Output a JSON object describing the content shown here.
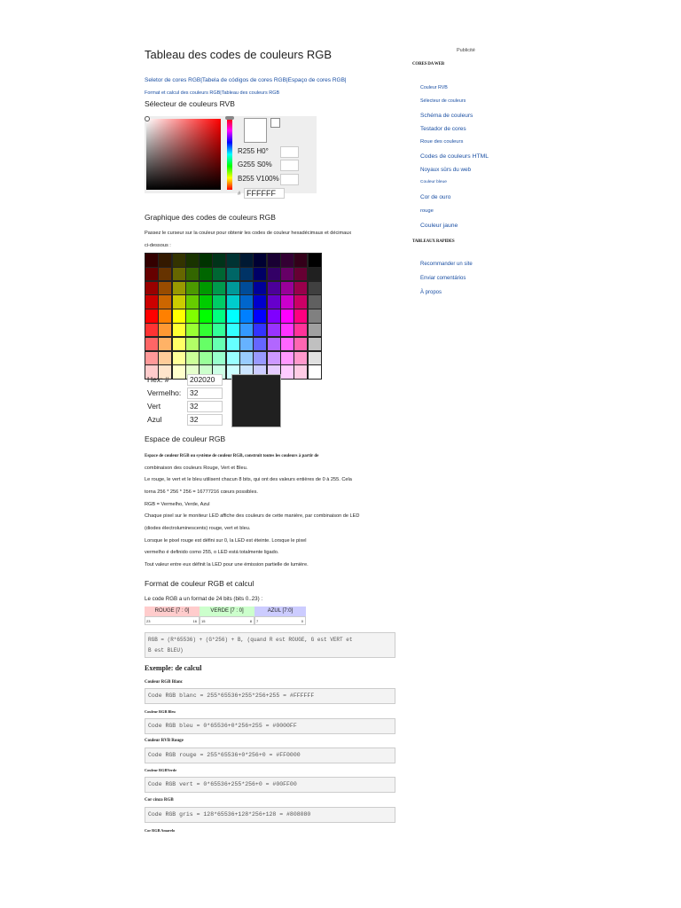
{
  "title": "Tableau des codes de couleurs RGB",
  "nav_links": {
    "line1": "Seletor de cores RGB|Tabela de códigos de cores RGB|Espaço de cores RGB|",
    "line2": "Format et calcul des couleurs RGB|Tableau des couleurs RGB"
  },
  "picker": {
    "heading": "Sélecteur de couleurs RVB",
    "r_label": "R",
    "r_val": "255",
    "h_label": "H",
    "h_val": "0",
    "h_unit": "°",
    "g_label": "G",
    "g_val": "255",
    "s_label": "S",
    "s_val": "0",
    "s_unit": "%",
    "b_label": "B",
    "b_val": "255",
    "v_label": "V",
    "v_val": "100",
    "v_unit": "%",
    "hex_symbol": "#",
    "hex": "FFFFFF"
  },
  "chart_section": {
    "heading": "Graphique des codes de couleurs RGB",
    "intro1": "Passez le curseur sur la couleur pour obtenir les codes de couleur hexadécimaux et décimaux",
    "intro2": "ci-dessous :"
  },
  "palette": [
    [
      "#330000",
      "#331900",
      "#333300",
      "#193300",
      "#003300",
      "#003319",
      "#003333",
      "#001933",
      "#000033",
      "#190033",
      "#330033",
      "#330019",
      "#000000"
    ],
    [
      "#660000",
      "#663300",
      "#666600",
      "#336600",
      "#006600",
      "#006633",
      "#006666",
      "#003366",
      "#000066",
      "#330066",
      "#660066",
      "#660033",
      "#202020"
    ],
    [
      "#990000",
      "#994C00",
      "#999900",
      "#4C9900",
      "#009900",
      "#00994C",
      "#009999",
      "#004C99",
      "#000099",
      "#4C0099",
      "#990099",
      "#99004C",
      "#404040"
    ],
    [
      "#CC0000",
      "#CC6600",
      "#CCCC00",
      "#66CC00",
      "#00CC00",
      "#00CC66",
      "#00CCCC",
      "#0066CC",
      "#0000CC",
      "#6600CC",
      "#CC00CC",
      "#CC0066",
      "#606060"
    ],
    [
      "#FF0000",
      "#FF8000",
      "#FFFF00",
      "#80FF00",
      "#00FF00",
      "#00FF80",
      "#00FFFF",
      "#0080FF",
      "#0000FF",
      "#7F00FF",
      "#FF00FF",
      "#FF007F",
      "#808080"
    ],
    [
      "#FF3333",
      "#FF9933",
      "#FFFF33",
      "#99FF33",
      "#33FF33",
      "#33FF99",
      "#33FFFF",
      "#3399FF",
      "#3333FF",
      "#9933FF",
      "#FF33FF",
      "#FF3399",
      "#A0A0A0"
    ],
    [
      "#FF6666",
      "#FFB266",
      "#FFFF66",
      "#B2FF66",
      "#66FF66",
      "#66FFB2",
      "#66FFFF",
      "#66B2FF",
      "#6666FF",
      "#B266FF",
      "#FF66FF",
      "#FF66B2",
      "#C0C0C0"
    ],
    [
      "#FF9999",
      "#FFCC99",
      "#FFFF99",
      "#CCFF99",
      "#99FF99",
      "#99FFCC",
      "#99FFFF",
      "#99CCFF",
      "#9999FF",
      "#CC99FF",
      "#FF99FF",
      "#FF99CC",
      "#E0E0E0"
    ],
    [
      "#FFCCCC",
      "#FFE5CC",
      "#FFFFCC",
      "#E5FFCC",
      "#CCFFCC",
      "#CCFFE5",
      "#CCFFFF",
      "#CCE5FF",
      "#CCCCFF",
      "#E5CCFF",
      "#FFCCFF",
      "#FFCCE5",
      "#FFFFFF"
    ]
  ],
  "selected": {
    "hex_label": "Hex: #",
    "hex": "202020",
    "r_label": "Vermelho:",
    "r": "32",
    "g_label": "Vert",
    "g": "32",
    "b_label": "Azul",
    "b": "32",
    "preview_color": "#202020"
  },
  "space": {
    "heading": "Espace de couleur RGB",
    "p1a": "Espace de couleur RGB ou système de couleur RGB, construit toutes les couleurs à partir de",
    "p1b": "combinaison des couleurs Rouge, Vert et Bleu.",
    "p2a": "Le rouge, le vert et le bleu utilisent chacun 8 bits, qui ont des valeurs entières de 0 à 255. Cela",
    "p2b": "torna 256 * 256 * 256 = 16777216 cœurs possibles.",
    "p3": "RGB = Vermelho, Verde, Azul",
    "p4a": "Chaque pixel sur le moniteur LED affiche des couleurs de cette manière, par combinaison de LED",
    "p4b": "(diodes électroluminescents) rouge, vert et bleu.",
    "p5a": "Lorsque le pixel rouge est défini sur 0, la LED est éteinte. Lorsque le pixel",
    "p5b": "vermelho é definido como 255, o LED está totalmente ligado.",
    "p6": "Tout valeur entre eux définit la LED pour une émission partielle de lumière."
  },
  "format": {
    "heading": "Format de couleur RGB et calcul",
    "intro": "Le code RGB a un format de 24 bits (bits 0..23) :",
    "red_label": "ROUGE [7 : 0]",
    "green_label": "VERDE [7 : 0]",
    "blue_label": "AZUL [7:0]",
    "bit23": "23",
    "bit16": "16",
    "bit15": "15",
    "bit8": "8",
    "bit7": "7",
    "bit0": "0",
    "formula1": "RGB = (R*65536) + (G*256) + B, (quand R est ROUGE, G est VERT et",
    "formula2": "B est BLEU)",
    "example_heading": "Exemple: de calcul",
    "white_label": "Couleur RGB Blanc",
    "white_code": "Code RGB blanc = 255*65536+255*256+255 = #FFFFFF",
    "blue_label_ex": "Couleur RGB Bleu",
    "blue_code": "Code RGB bleu = 0*65536+0*256+255 = #0000FF",
    "red_label_ex": "Couleur RVB Rouge",
    "red_code": "Code RGB rouge = 255*65536+0*256+0 = #FF0000",
    "green_label_ex": "Couleur RGBVerde",
    "green_code": "Code RGB vert = 0*65536+255*256+0 = #00FF00",
    "gray_label_ex": "Cor cinza RGB",
    "gray_code": "Code RGB gris = 128*65536+128*256+128 = #808080",
    "yellow_label_ex": "Cor RGB Amarelo"
  },
  "sidebar": {
    "ad": "Publicité",
    "head1": "CORES DA WEB",
    "items1": [
      "Couleur RVB",
      "Sélecteur de couleurs",
      "Schéma de couleurs",
      "Testador de cores",
      "Roue des couleurs",
      "Codes de couleurs HTML",
      "Noyaux sûrs du web",
      "Couleur bleue",
      "Cor de ouro",
      "rouge",
      "Couleur jaune"
    ],
    "head2": "TABLEAUX RAPIDES",
    "items2": [
      "Recommander un site",
      "Enviar comentários",
      "À propos"
    ]
  }
}
